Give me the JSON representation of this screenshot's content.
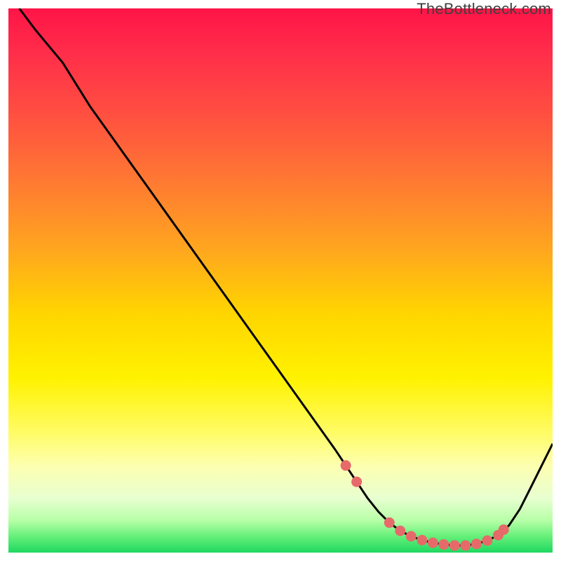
{
  "watermark": "TheBottleneck.com",
  "chart_data": {
    "type": "line",
    "title": "",
    "xlabel": "",
    "ylabel": "",
    "xlim": [
      0,
      100
    ],
    "ylim": [
      0,
      100
    ],
    "series": [
      {
        "name": "curve",
        "x": [
          2,
          5,
          10,
          15,
          20,
          25,
          30,
          35,
          40,
          45,
          50,
          55,
          60,
          62,
          64,
          66,
          68,
          70,
          72,
          74,
          76,
          78,
          80,
          82,
          84,
          86,
          88,
          90,
          92,
          94,
          96,
          98,
          100
        ],
        "y": [
          100,
          96,
          90,
          82,
          75,
          68,
          61,
          54,
          47,
          40,
          33,
          26,
          19,
          16,
          13,
          10,
          7.5,
          5.5,
          4,
          3,
          2.3,
          1.8,
          1.5,
          1.3,
          1.3,
          1.6,
          2.2,
          3.2,
          5,
          8,
          12,
          16,
          20
        ]
      }
    ],
    "markers": {
      "name": "highlight-dots",
      "x": [
        62,
        64,
        70,
        72,
        74,
        76,
        78,
        80,
        82,
        84,
        86,
        88,
        90,
        91
      ],
      "y": [
        16,
        13,
        5.5,
        4,
        3,
        2.3,
        1.8,
        1.5,
        1.3,
        1.3,
        1.6,
        2.2,
        3.2,
        4.2
      ]
    },
    "gradient_axis": "y",
    "gradient_stops": [
      {
        "pos": 0.0,
        "color": "#ff1447"
      },
      {
        "pos": 0.2,
        "color": "#ff5140"
      },
      {
        "pos": 0.44,
        "color": "#ffa51f"
      },
      {
        "pos": 0.68,
        "color": "#fff200"
      },
      {
        "pos": 0.88,
        "color": "#e8ffd0"
      },
      {
        "pos": 1.0,
        "color": "#1ed760"
      }
    ]
  }
}
